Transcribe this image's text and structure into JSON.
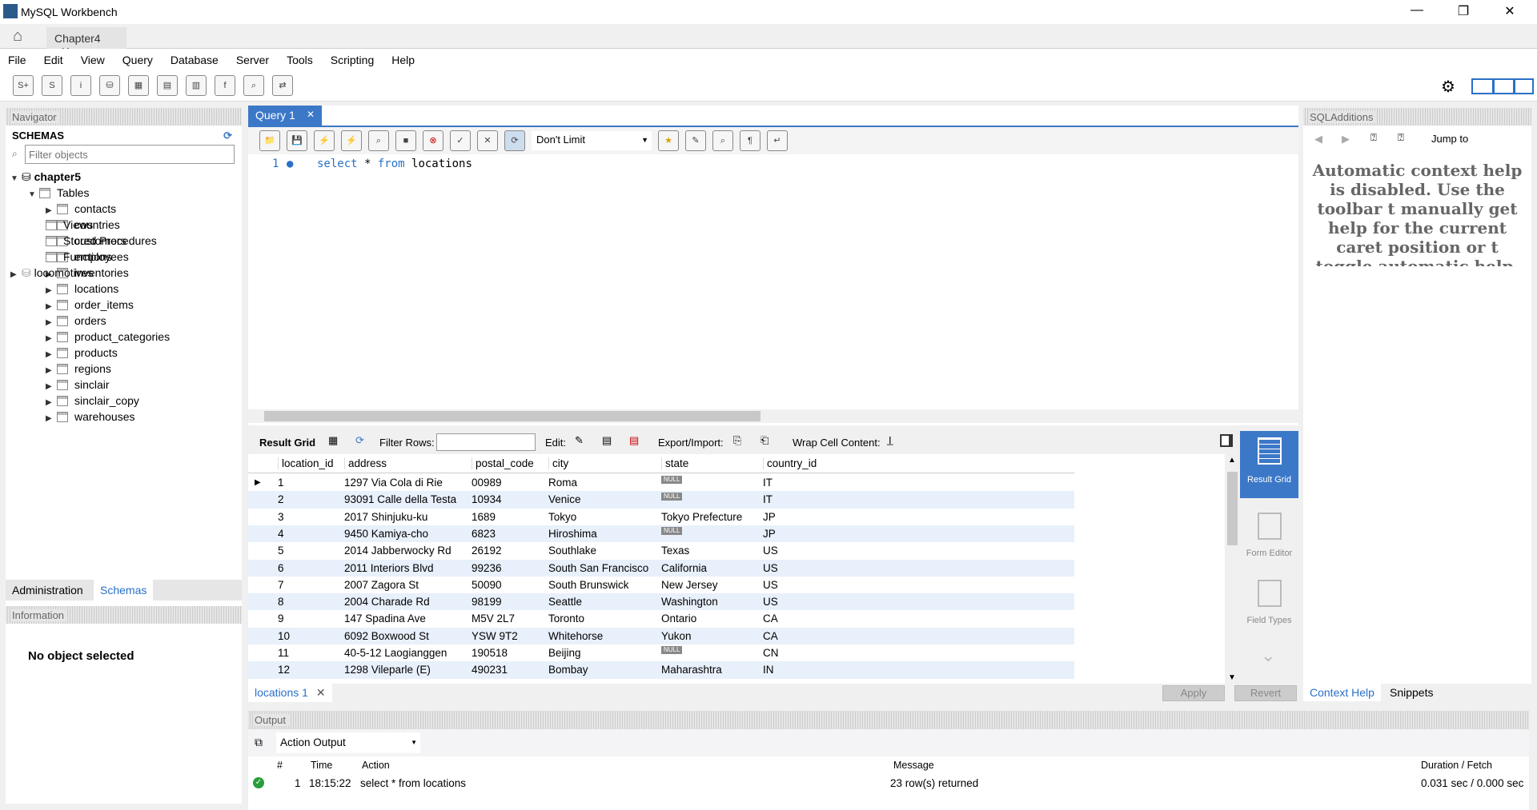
{
  "app": {
    "title": "MySQL Workbench",
    "doc_tab": "Chapter4"
  },
  "menu": [
    "File",
    "Edit",
    "View",
    "Query",
    "Database",
    "Server",
    "Tools",
    "Scripting",
    "Help"
  ],
  "navigator": {
    "title": "Navigator",
    "schemas_label": "SCHEMAS",
    "filter_placeholder": "Filter objects",
    "schema": "chapter5",
    "tables_label": "Tables",
    "tables": [
      "contacts",
      "countries",
      "customers",
      "employees",
      "inventories",
      "locations",
      "order_items",
      "orders",
      "product_categories",
      "products",
      "regions",
      "sinclair",
      "sinclair_copy",
      "warehouses"
    ],
    "other": [
      "Views",
      "Stored Procedures",
      "Functions"
    ],
    "schema2": "locomotives",
    "tabs": [
      "Administration",
      "Schemas"
    ],
    "info_title": "Information",
    "info_text": "No object selected"
  },
  "editor": {
    "tab": "Query 1",
    "limit": "Don't Limit",
    "line_no": "1",
    "code": {
      "k1": "select",
      "mid": " * ",
      "k2": "from",
      "rest": " locations"
    }
  },
  "result_toolbar": {
    "result_grid": "Result Grid",
    "filter_rows": "Filter Rows:",
    "edit": "Edit:",
    "export_import": "Export/Import:",
    "wrap": "Wrap Cell Content:"
  },
  "grid": {
    "columns": [
      "location_id",
      "address",
      "postal_code",
      "city",
      "state",
      "country_id"
    ],
    "null_label": "NULL",
    "rows": [
      [
        "1",
        "1297 Via Cola di Rie",
        "00989",
        "Roma",
        null,
        "IT"
      ],
      [
        "2",
        "93091 Calle della Testa",
        "10934",
        "Venice",
        null,
        "IT"
      ],
      [
        "3",
        "2017 Shinjuku-ku",
        "1689",
        "Tokyo",
        "Tokyo Prefecture",
        "JP"
      ],
      [
        "4",
        "9450 Kamiya-cho",
        "6823",
        "Hiroshima",
        null,
        "JP"
      ],
      [
        "5",
        "2014 Jabberwocky Rd",
        "26192",
        "Southlake",
        "Texas",
        "US"
      ],
      [
        "6",
        "2011 Interiors Blvd",
        "99236",
        "South San Francisco",
        "California",
        "US"
      ],
      [
        "7",
        "2007 Zagora St",
        "50090",
        "South Brunswick",
        "New Jersey",
        "US"
      ],
      [
        "8",
        "2004 Charade Rd",
        "98199",
        "Seattle",
        "Washington",
        "US"
      ],
      [
        "9",
        "147 Spadina Ave",
        "M5V 2L7",
        "Toronto",
        "Ontario",
        "CA"
      ],
      [
        "10",
        "6092 Boxwood St",
        "YSW 9T2",
        "Whitehorse",
        "Yukon",
        "CA"
      ],
      [
        "11",
        "40-5-12 Laogianggen",
        "190518",
        "Beijing",
        null,
        "CN"
      ],
      [
        "12",
        "1298 Vileparle (E)",
        "490231",
        "Bombay",
        "Maharashtra",
        "IN"
      ]
    ]
  },
  "side_buttons": [
    "Result Grid",
    "Form Editor",
    "Field Types"
  ],
  "results_tab": "locations 1",
  "apply": "Apply",
  "revert": "Revert",
  "sql_additions": {
    "title": "SQLAdditions",
    "jump_to": "Jump to",
    "help": "Automatic context help is disabled. Use the toolbar t manually get help for the current caret position or t toggle automatic help.",
    "tabs": [
      "Context Help",
      "Snippets"
    ]
  },
  "output": {
    "title": "Output",
    "selector": "Action Output",
    "headers": [
      "#",
      "Time",
      "Action",
      "Message",
      "Duration / Fetch"
    ],
    "rows": [
      {
        "n": "1",
        "time": "18:15:22",
        "action": "select * from locations",
        "message": "23 row(s) returned",
        "duration": "0.031 sec / 0.000 sec"
      }
    ]
  },
  "colors": {
    "accent": "#3c78c8",
    "row_alt": "#e8f0fb",
    "ok": "#2a9d3a"
  }
}
